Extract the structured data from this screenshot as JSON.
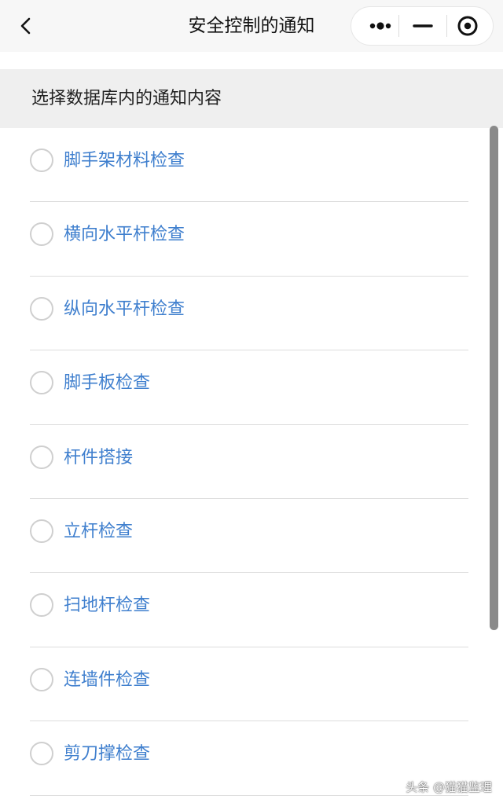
{
  "navbar": {
    "title": "安全控制的通知",
    "back_icon": "chevron-left-icon",
    "capsule": {
      "more_icon": "more-dots-icon",
      "minimize_icon": "minimize-icon",
      "close_icon": "target-circle-icon"
    }
  },
  "section": {
    "title": "选择数据库内的通知内容"
  },
  "items": [
    {
      "label": "脚手架材料检查",
      "selected": false
    },
    {
      "label": "横向水平杆检查",
      "selected": false
    },
    {
      "label": "纵向水平杆检查",
      "selected": false
    },
    {
      "label": "脚手板检查",
      "selected": false
    },
    {
      "label": "杆件搭接",
      "selected": false
    },
    {
      "label": "立杆检查",
      "selected": false
    },
    {
      "label": "扫地杆检查",
      "selected": false
    },
    {
      "label": "连墙件检查",
      "selected": false
    },
    {
      "label": "剪刀撑检查",
      "selected": false
    }
  ],
  "watermark": "头条 @猫猫监理",
  "colors": {
    "item_text": "#3f7fce",
    "navbar_bg": "#f7f7f7",
    "section_bg": "#efefef"
  }
}
